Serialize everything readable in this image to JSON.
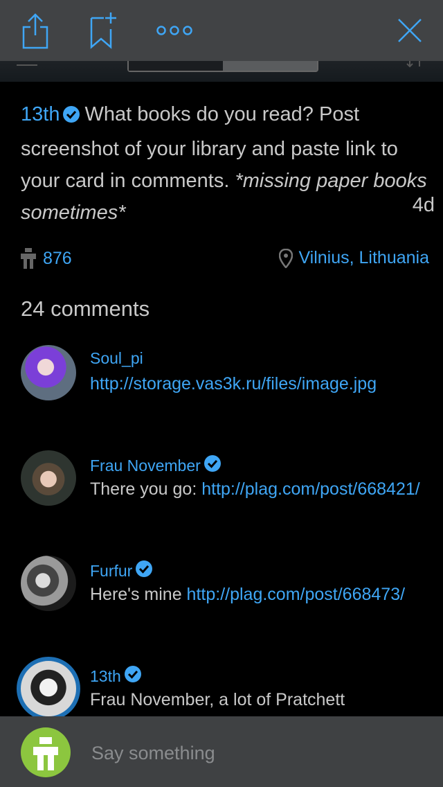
{
  "toolbar": {
    "share_icon": "share-icon",
    "bookmark_icon": "bookmark-add-icon",
    "more_icon": "more-icon",
    "close_icon": "close-icon"
  },
  "post": {
    "author": "13th",
    "text_plain": "What books do you read? Post screenshot of your library and paste link to your card in comments. ",
    "text_italic": "*missing paper books sometimes*",
    "age": "4d",
    "likes": "876",
    "location": "Vilnius, Lithuania"
  },
  "comments_title": "24 comments",
  "comments": [
    {
      "author": "Soul_pi",
      "text": "",
      "link": "http://storage.vas3k.ru/files/image.jpg"
    },
    {
      "author": "Frau November",
      "text": "There you go: ",
      "link": "http://plag.com/post/668421/"
    },
    {
      "author": "Furfur",
      "text": "Here's mine ",
      "link": "http://plag.com/post/668473/"
    },
    {
      "author": "13th",
      "text": "Frau November, a lot of Pratchett",
      "link": ""
    }
  ],
  "composer": {
    "placeholder": "Say something"
  },
  "colors": {
    "accent": "#3fa6f5",
    "toolbar_bg": "#414345",
    "composer_avatar": "#8cc63f"
  }
}
